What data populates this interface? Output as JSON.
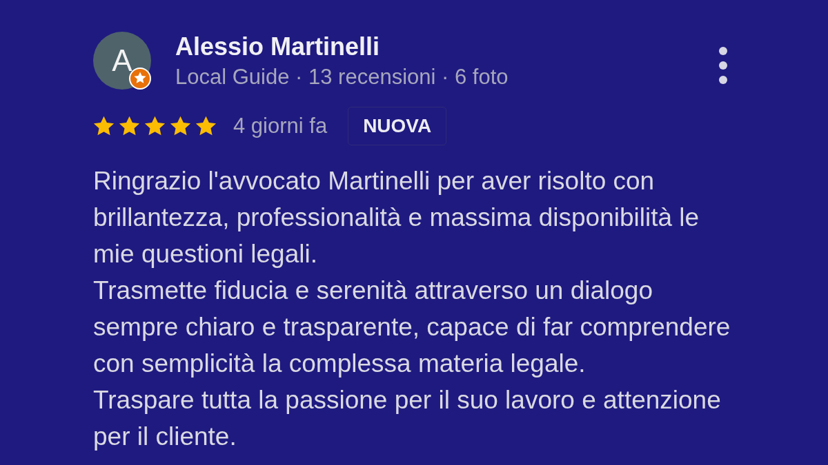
{
  "review": {
    "author": {
      "initial": "A",
      "name": "Alessio Martinelli",
      "local_guide": true,
      "meta": "Local Guide · 13 recensioni · 6 foto"
    },
    "stars": 5,
    "time": "4 giorni fa",
    "badge": "NUOVA",
    "paragraphs": [
      "Ringrazio l'avvocato Martinelli per aver risolto con brillantezza, professionalità e massima disponibilità le mie questioni legali.",
      "Trasmette fiducia e serenità attraverso un dialogo sempre chiaro e trasparente, capace di far comprendere con semplicità la complessa materia legale.",
      "Traspare tutta la passione per il suo lavoro e attenzione per il cliente."
    ]
  }
}
